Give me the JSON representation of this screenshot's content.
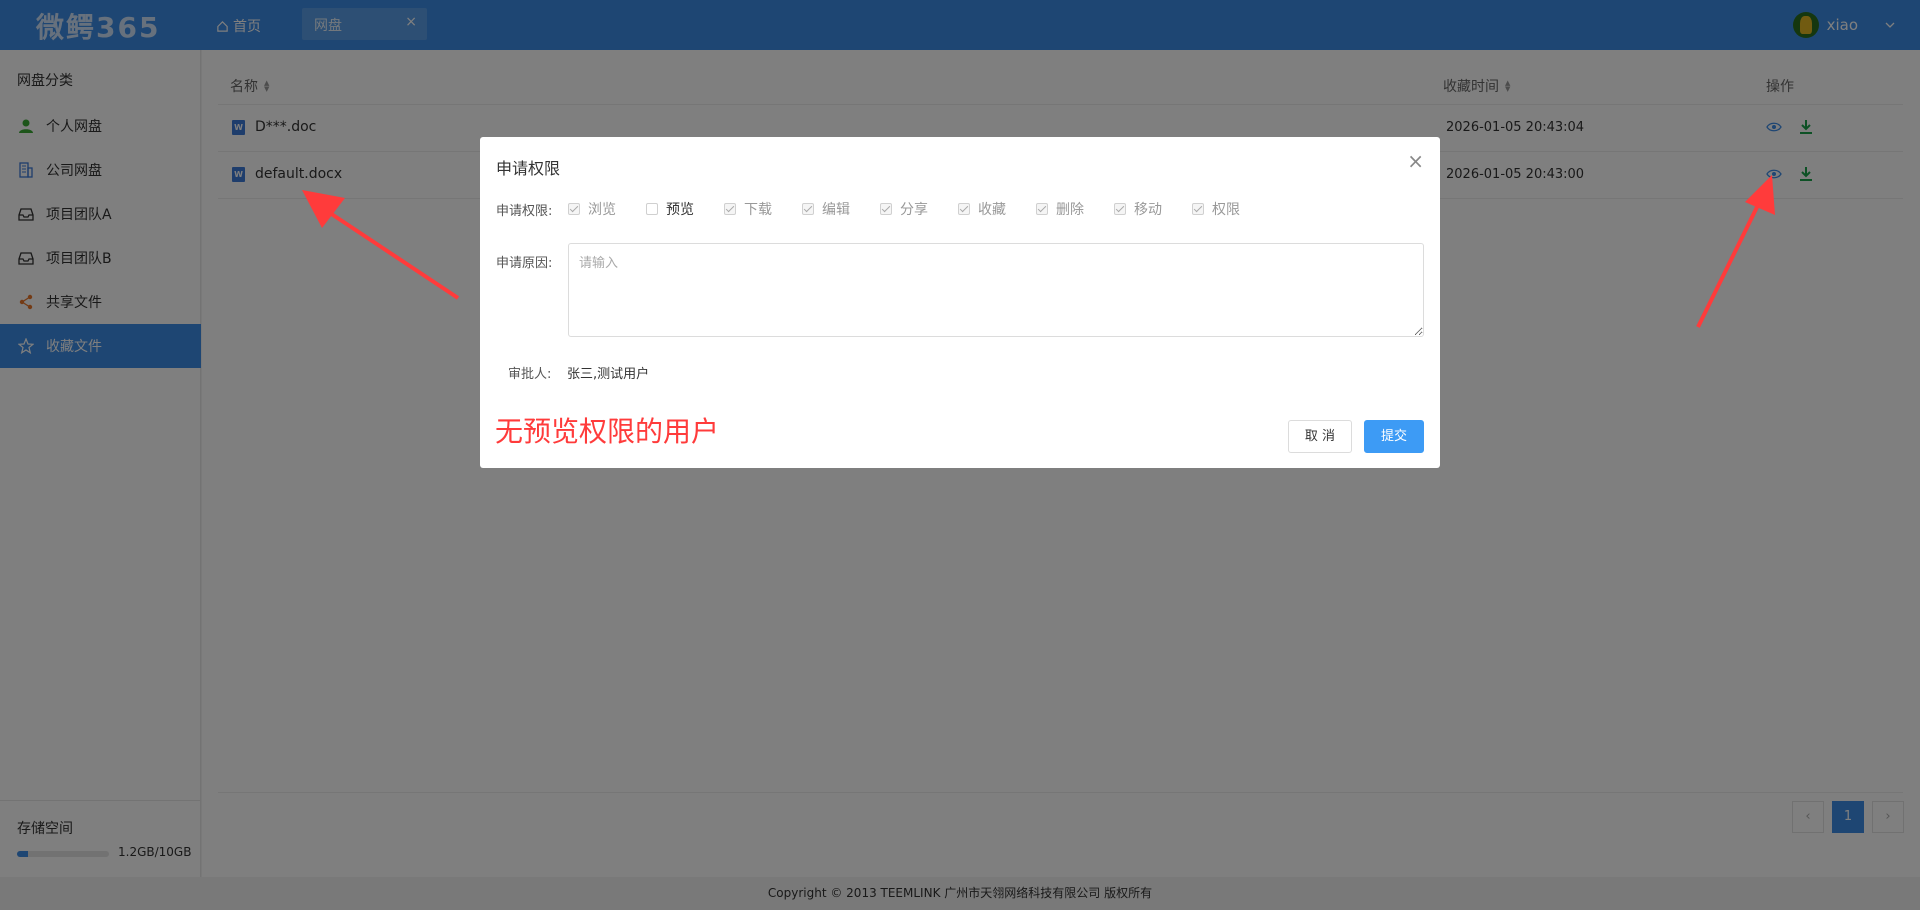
{
  "header": {
    "logo": "微鳄365",
    "home_label": "首页",
    "tab_label": "网盘",
    "tab_close": "×",
    "username": "xiao"
  },
  "sidebar": {
    "title": "网盘分类",
    "items": [
      {
        "label": "个人网盘",
        "icon": "user-icon"
      },
      {
        "label": "公司网盘",
        "icon": "building-icon"
      },
      {
        "label": "项目团队A",
        "icon": "inbox-icon"
      },
      {
        "label": "项目团队B",
        "icon": "inbox-icon"
      },
      {
        "label": "共享文件",
        "icon": "share-icon"
      },
      {
        "label": "收藏文件",
        "icon": "star-icon",
        "active": true
      }
    ],
    "storage": {
      "title": "存储空间",
      "usage_text": "1.2GB/10GB",
      "used_fraction": 0.12
    }
  },
  "table": {
    "columns": {
      "name": "名称",
      "time": "收藏时间",
      "actions": "操作"
    },
    "rows": [
      {
        "name": "D***.doc",
        "time": "2026-01-05 20:43:04"
      },
      {
        "name": "default.docx",
        "time": "2026-01-05 20:43:00"
      }
    ]
  },
  "pagination": {
    "prev": "‹",
    "current": "1",
    "next": "›"
  },
  "footer": {
    "copyright": "Copyright © 2013 TEEMLINK 广州市天翎网络科技有限公司 版权所有"
  },
  "modal": {
    "title": "申请权限",
    "close": "×",
    "permission_label": "申请权限:",
    "permissions": [
      {
        "label": "浏览",
        "checked": true,
        "enabled": false
      },
      {
        "label": "预览",
        "checked": false,
        "enabled": true
      },
      {
        "label": "下载",
        "checked": true,
        "enabled": false
      },
      {
        "label": "编辑",
        "checked": true,
        "enabled": false
      },
      {
        "label": "分享",
        "checked": true,
        "enabled": false
      },
      {
        "label": "收藏",
        "checked": true,
        "enabled": false
      },
      {
        "label": "删除",
        "checked": true,
        "enabled": false
      },
      {
        "label": "移动",
        "checked": true,
        "enabled": false
      },
      {
        "label": "权限",
        "checked": true,
        "enabled": false
      }
    ],
    "reason_label": "申请原因:",
    "reason_placeholder": "请输入",
    "approver_label": "审批人:",
    "approver_value": "张三,测试用户",
    "cancel_label": "取 消",
    "submit_label": "提交"
  },
  "annotation": {
    "note": "无预览权限的用户",
    "color": "#ff3b3b"
  },
  "colors": {
    "primary": "#3d8ce6",
    "submit": "#3d9bf5",
    "download": "#1aa34a"
  }
}
